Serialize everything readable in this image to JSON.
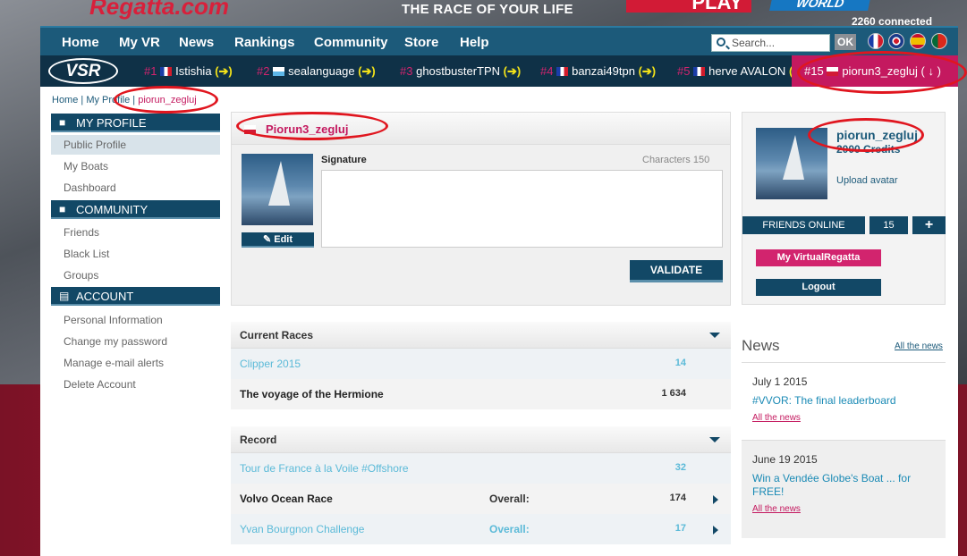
{
  "banner": {
    "logo_fragment": "Regatta.com",
    "tagline": "THE RACE OF YOUR LIFE",
    "play_label": "PLAY",
    "world_label": "WORLD",
    "connected": "2260 connected"
  },
  "nav": {
    "items": [
      "Home",
      "My VR",
      "News",
      "Rankings",
      "Community",
      "Store",
      "Help"
    ],
    "search_placeholder": "Search...",
    "ok_label": "OK"
  },
  "rankbar": {
    "logo": "VSR",
    "entries": [
      {
        "rank": "#1",
        "flag": "fr",
        "name": "Istishia",
        "arrow": "(➔)"
      },
      {
        "rank": "#2",
        "flag": "sm",
        "name": "sealanguage",
        "arrow": "(➔)"
      },
      {
        "rank": "#3",
        "flag": "none",
        "name": "ghostbusterTPN",
        "arrow": "(➔)"
      },
      {
        "rank": "#4",
        "flag": "fr",
        "name": "banzai49tpn",
        "arrow": "(➔)"
      },
      {
        "rank": "#5",
        "flag": "fr",
        "name": "herve AVALON",
        "arrow": "(➔"
      }
    ],
    "me": {
      "rank": "#15",
      "flag": "pl",
      "name": "piorun3_zegluj",
      "arrow": "( ↓ )"
    }
  },
  "breadcrumb": {
    "home": "Home",
    "sep1": " | ",
    "profile": "My Profile",
    "sep2": " | ",
    "current": "piorun_zegluj"
  },
  "sidebar": {
    "my_profile": {
      "title": "MY PROFILE",
      "items": [
        "Public Profile",
        "My Boats",
        "Dashboard"
      ]
    },
    "community": {
      "title": "COMMUNITY",
      "items": [
        "Friends",
        "Black List",
        "Groups"
      ]
    },
    "account": {
      "title": "ACCOUNT",
      "items": [
        "Personal Information",
        "Change my password",
        "Manage e-mail alerts",
        "Delete Account"
      ]
    }
  },
  "profile": {
    "username": "Piorun3_zegluj",
    "edit_label": "Edit",
    "signature_label": "Signature",
    "characters": "Characters 150",
    "validate_label": "VALIDATE"
  },
  "current_races": {
    "title": "Current Races",
    "rows": [
      {
        "name": "Clipper 2015",
        "overall": "",
        "count": "14"
      },
      {
        "name": "The voyage of the Hermione",
        "overall": "",
        "count": "1 634"
      }
    ]
  },
  "record": {
    "title": "Record",
    "rows": [
      {
        "name": "Tour de France à la Voile #Offshore",
        "overall": "",
        "count": "32"
      },
      {
        "name": "Volvo Ocean Race",
        "overall": "Overall:",
        "count": "174"
      },
      {
        "name": "Yvan Bourgnon Challenge",
        "overall": "Overall:",
        "count": "17"
      }
    ]
  },
  "account_panel": {
    "name": "piorun_zegluj",
    "credits": "2000 Credits",
    "upload": "Upload avatar",
    "friends_online": "FRIENDS ONLINE",
    "friends_count": "15",
    "add": "+",
    "my_vr": "My VirtualRegatta",
    "logout": "Logout"
  },
  "news": {
    "title": "News",
    "all_link": "All the news",
    "items": [
      {
        "date": "July 1 2015",
        "headline": "#VVOR: The final leaderboard",
        "link": "All the news"
      },
      {
        "date": "June 19 2015",
        "headline": "Win a Vendée Globe's Boat ... for FREE!",
        "link": "All the news"
      }
    ]
  },
  "colors": {
    "navy": "#124866",
    "magenta": "#c4195f",
    "link_cyan": "#5bbad8",
    "annotation_red": "#e0161f"
  }
}
